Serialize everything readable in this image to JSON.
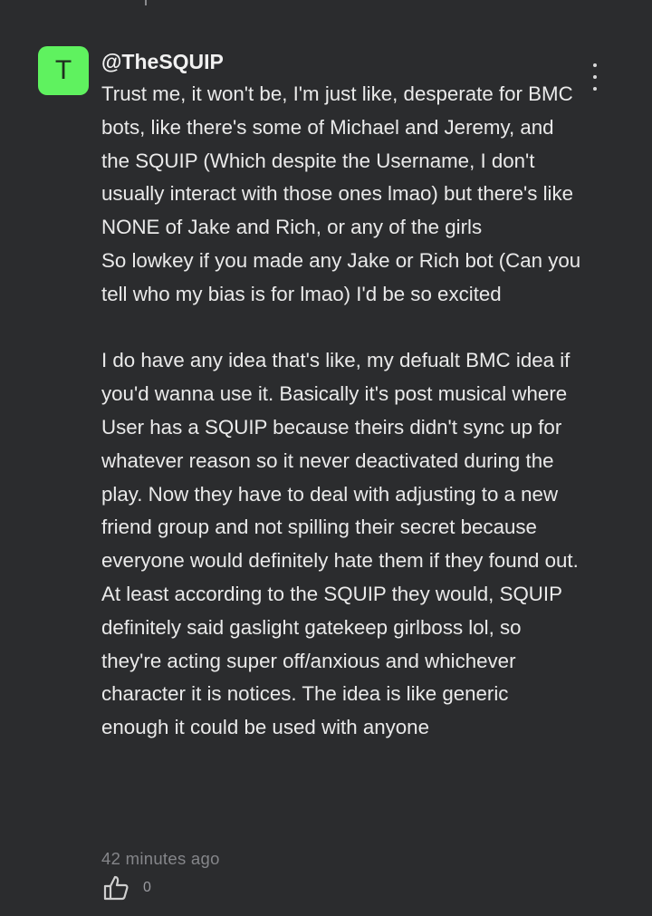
{
  "comment": {
    "avatar_letter": "T",
    "avatar_color": "#5ff25f",
    "username": "@TheSQUIP",
    "more_icon": "more-vertical-icon",
    "body": [
      "Trust me, it won't be, I'm just like, desperate for BMC bots, like there's some of Michael and Jeremy, and the SQUIP (Which despite the Username, I don't usually interact with those ones lmao) but there's like NONE of Jake and Rich, or any of the girls\nSo lowkey if you made any Jake or Rich bot (Can you tell who my bias is for lmao) I'd be so excited",
      "I do have any idea that's like, my defualt BMC idea if you'd wanna use it. Basically it's post musical where User has a SQUIP because theirs didn't sync up for whatever reason so it never deactivated during the play. Now they have to deal with adjusting to a new friend group and not spilling their secret because everyone would definitely hate them if they found out. At least according to the SQUIP they would, SQUIP definitely said gaslight gatekeep girlboss lol, so they're acting super off/anxious and whichever character it is notices. The idea is like generic enough it could be used with anyone"
    ],
    "timestamp": "42 minutes ago",
    "like_icon": "thumbs-up-icon",
    "like_count": "0"
  },
  "theme": {
    "background": "#2b2c2e",
    "text": "#eaeaea",
    "muted": "#85868a"
  }
}
